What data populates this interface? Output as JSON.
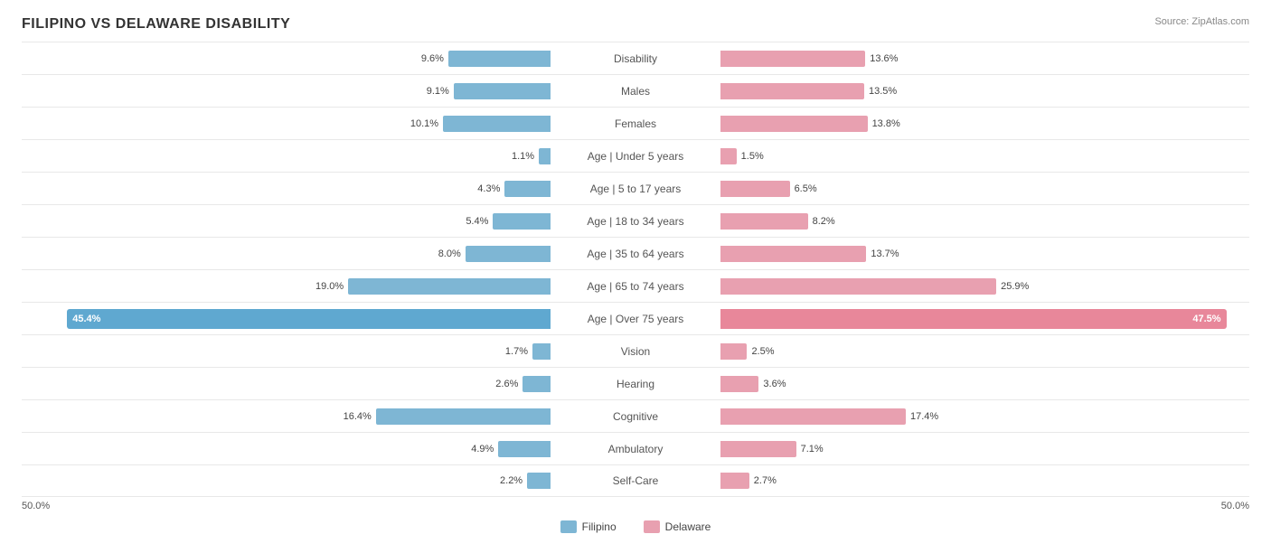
{
  "title": "FILIPINO VS DELAWARE DISABILITY",
  "source": "Source: ZipAtlas.com",
  "colors": {
    "blue": "#7eb6d4",
    "blue_dark": "#5fa8d0",
    "pink": "#e8a0b0",
    "pink_dark": "#e8879a"
  },
  "legend": {
    "left_label": "Filipino",
    "right_label": "Delaware"
  },
  "axis": {
    "left": "50.0%",
    "right": "50.0%"
  },
  "rows": [
    {
      "label": "Disability",
      "left_val": "9.6%",
      "left_pct": 9.6,
      "right_val": "13.6%",
      "right_pct": 13.6
    },
    {
      "label": "Males",
      "left_val": "9.1%",
      "left_pct": 9.1,
      "right_val": "13.5%",
      "right_pct": 13.5
    },
    {
      "label": "Females",
      "left_val": "10.1%",
      "left_pct": 10.1,
      "right_val": "13.8%",
      "right_pct": 13.8
    },
    {
      "label": "Age | Under 5 years",
      "left_val": "1.1%",
      "left_pct": 1.1,
      "right_val": "1.5%",
      "right_pct": 1.5
    },
    {
      "label": "Age | 5 to 17 years",
      "left_val": "4.3%",
      "left_pct": 4.3,
      "right_val": "6.5%",
      "right_pct": 6.5
    },
    {
      "label": "Age | 18 to 34 years",
      "left_val": "5.4%",
      "left_pct": 5.4,
      "right_val": "8.2%",
      "right_pct": 8.2
    },
    {
      "label": "Age | 35 to 64 years",
      "left_val": "8.0%",
      "left_pct": 8.0,
      "right_val": "13.7%",
      "right_pct": 13.7
    },
    {
      "label": "Age | 65 to 74 years",
      "left_val": "19.0%",
      "left_pct": 19.0,
      "right_val": "25.9%",
      "right_pct": 25.9
    },
    {
      "label": "Age | Over 75 years",
      "left_val": "45.4%",
      "left_pct": 45.4,
      "right_val": "47.5%",
      "right_pct": 47.5,
      "large": true
    },
    {
      "label": "Vision",
      "left_val": "1.7%",
      "left_pct": 1.7,
      "right_val": "2.5%",
      "right_pct": 2.5
    },
    {
      "label": "Hearing",
      "left_val": "2.6%",
      "left_pct": 2.6,
      "right_val": "3.6%",
      "right_pct": 3.6
    },
    {
      "label": "Cognitive",
      "left_val": "16.4%",
      "left_pct": 16.4,
      "right_val": "17.4%",
      "right_pct": 17.4
    },
    {
      "label": "Ambulatory",
      "left_val": "4.9%",
      "left_pct": 4.9,
      "right_val": "7.1%",
      "right_pct": 7.1
    },
    {
      "label": "Self-Care",
      "left_val": "2.2%",
      "left_pct": 2.2,
      "right_val": "2.7%",
      "right_pct": 2.7
    }
  ]
}
